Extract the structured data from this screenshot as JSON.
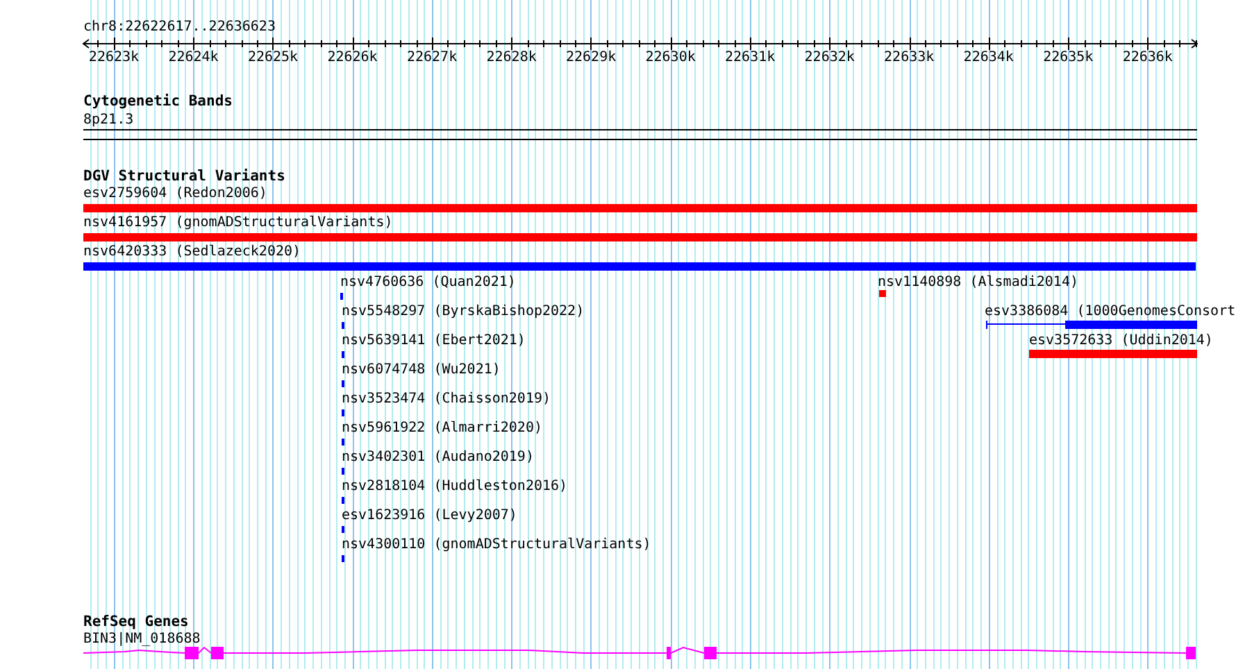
{
  "location": "chr8:22622617..22636623",
  "ruler": {
    "ticks": [
      "22623k",
      "22624k",
      "22625k",
      "22626k",
      "22627k",
      "22628k",
      "22629k",
      "22630k",
      "22631k",
      "22632k",
      "22633k",
      "22634k",
      "22635k",
      "22636k"
    ]
  },
  "tracks": [
    {
      "kind": "cytoband",
      "title": "Cytogenetic Bands",
      "band": "8p21.3"
    },
    {
      "kind": "variants",
      "title": "DGV Structural Variants",
      "features": [
        {
          "label": "esv2759604 (Redon2006)",
          "color": "#ff0000"
        },
        {
          "label": "nsv4161957 (gnomADStructuralVariants)",
          "color": "#ff0000"
        },
        {
          "label": "nsv6420333 (Sedlazeck2020)",
          "color": "#0000ff"
        },
        {
          "label": "nsv4760636 (Quan2021)",
          "color": "#0000ff"
        },
        {
          "label": "nsv1140898 (Alsmadi2014)",
          "color": "#ff0000"
        },
        {
          "label": "nsv5548297 (ByrskaBishop2022)",
          "color": "#0000ff"
        },
        {
          "label": "esv3386084 (1000GenomesConsort",
          "color": "#0000ff"
        },
        {
          "label": "nsv5639141 (Ebert2021)",
          "color": "#0000ff"
        },
        {
          "label": "esv3572633 (Uddin2014)",
          "color": "#ff0000"
        },
        {
          "label": "nsv6074748 (Wu2021)",
          "color": "#0000ff"
        },
        {
          "label": "nsv3523474 (Chaisson2019)",
          "color": "#0000ff"
        },
        {
          "label": "nsv5961922 (Almarri2020)",
          "color": "#0000ff"
        },
        {
          "label": "nsv3402301 (Audano2019)",
          "color": "#0000ff"
        },
        {
          "label": "nsv2818104 (Huddleston2016)",
          "color": "#0000ff"
        },
        {
          "label": "esv1623916 (Levy2007)",
          "color": "#0000ff"
        },
        {
          "label": "nsv4300110 (gnomADStructuralVariants)",
          "color": "#0000ff"
        }
      ]
    },
    {
      "kind": "genes",
      "title": "RefSeq Genes",
      "genes": [
        {
          "label": "BIN3|NM_018688",
          "color": "#ff00ff"
        }
      ]
    }
  ]
}
